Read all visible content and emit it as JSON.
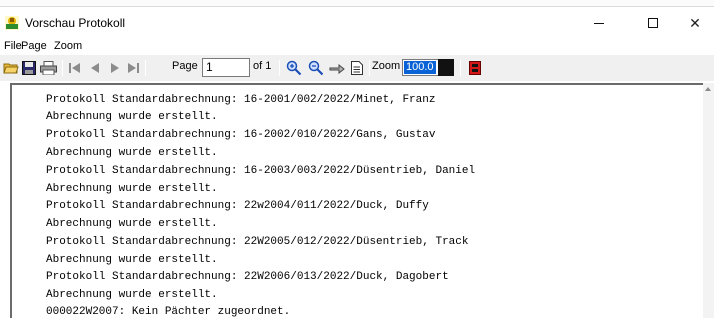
{
  "window": {
    "title": "Vorschau Protokoll",
    "close_glyph": "✕"
  },
  "menu": {
    "items": [
      "File",
      "Page",
      "Zoom"
    ]
  },
  "toolbar": {
    "page_label": "Page",
    "page_value": "1",
    "of_label": "of 1",
    "zoom_label": "Zoom",
    "zoom_value": "100.0",
    "icons": [
      "open-folder-icon",
      "save-icon",
      "print-icon",
      "first-page-icon",
      "previous-page-icon",
      "next-page-icon",
      "last-page-icon",
      "zoom-in-icon",
      "zoom-out-icon",
      "hand-icon",
      "page-icon",
      "exit-icon"
    ]
  },
  "report": {
    "lines": [
      "Protokoll Standardabrechnung: 16-2001/002/2022/Minet, Franz",
      "Abrechnung wurde erstellt.",
      "Protokoll Standardabrechnung: 16-2002/010/2022/Gans, Gustav",
      "Abrechnung wurde erstellt.",
      "Protokoll Standardabrechnung: 16-2003/003/2022/Düsentrieb, Daniel",
      "Abrechnung wurde erstellt.",
      "Protokoll Standardabrechnung: 22w2004/011/2022/Duck, Duffy",
      "Abrechnung wurde erstellt.",
      "Protokoll Standardabrechnung: 22W2005/012/2022/Düsentrieb, Track",
      "Abrechnung wurde erstellt.",
      "Protokoll Standardabrechnung: 22W2006/013/2022/Duck, Dagobert",
      "Abrechnung wurde erstellt.",
      "000022W2007: Kein Pächter zugeordnet."
    ]
  }
}
